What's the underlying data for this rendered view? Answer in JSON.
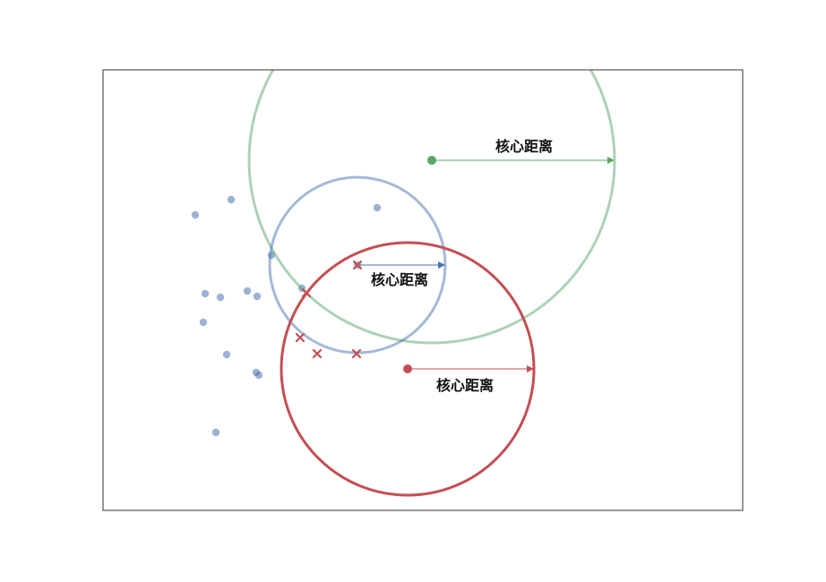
{
  "diagram": {
    "colors": {
      "blue": "#4c72b0",
      "green": "#55a868",
      "red": "#c44e52",
      "frame": "#333333",
      "text": "#111111"
    },
    "labels": {
      "green": "核心距离",
      "blue": "核心距离",
      "red": "核心距离"
    }
  }
}
